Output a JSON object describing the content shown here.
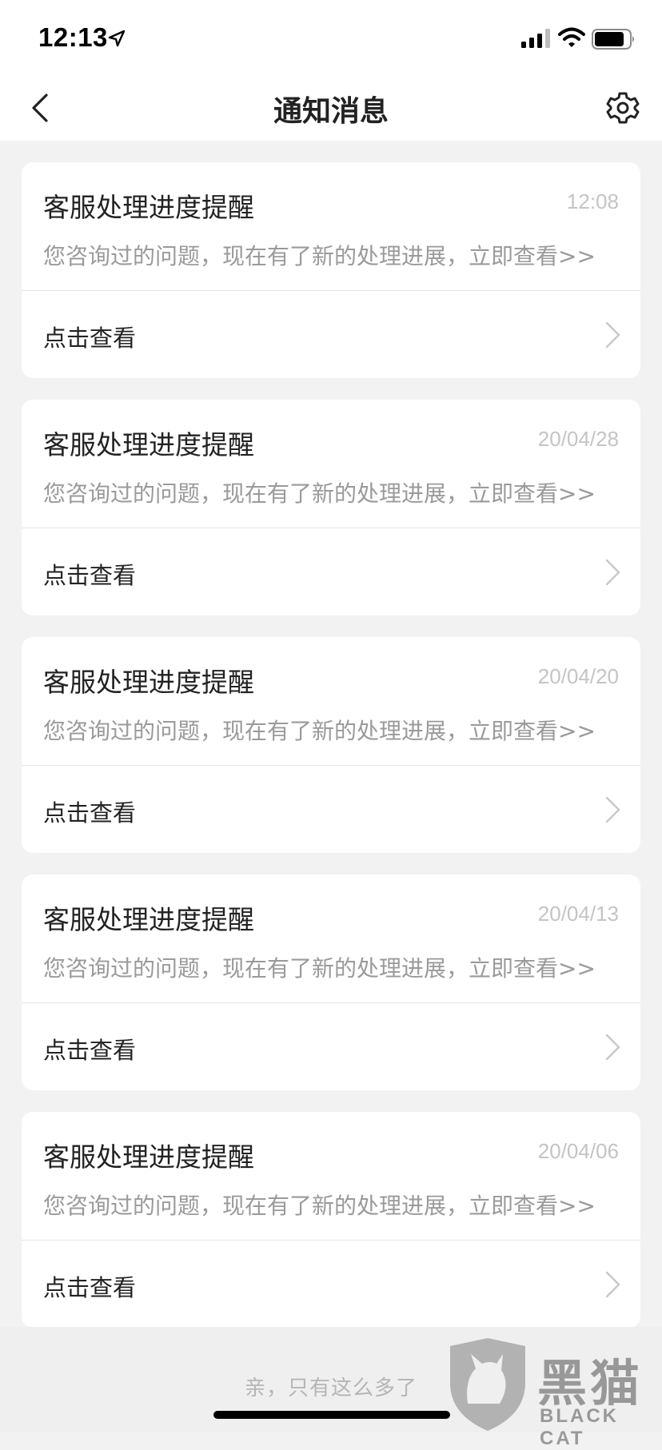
{
  "status_bar": {
    "time": "12:13"
  },
  "header": {
    "title": "通知消息"
  },
  "notifications": [
    {
      "title": "客服处理进度提醒",
      "time": "12:08",
      "desc": "您咨询过的问题，现在有了新的处理进展，立即查看>>",
      "action": "点击查看"
    },
    {
      "title": "客服处理进度提醒",
      "time": "20/04/28",
      "desc": "您咨询过的问题，现在有了新的处理进展，立即查看>>",
      "action": "点击查看"
    },
    {
      "title": "客服处理进度提醒",
      "time": "20/04/20",
      "desc": "您咨询过的问题，现在有了新的处理进展，立即查看>>",
      "action": "点击查看"
    },
    {
      "title": "客服处理进度提醒",
      "time": "20/04/13",
      "desc": "您咨询过的问题，现在有了新的处理进展，立即查看>>",
      "action": "点击查看"
    },
    {
      "title": "客服处理进度提醒",
      "time": "20/04/06",
      "desc": "您咨询过的问题，现在有了新的处理进展，立即查看>>",
      "action": "点击查看"
    }
  ],
  "footer": {
    "text": "亲，只有这么多了"
  },
  "watermark": {
    "label": "黑猫",
    "sub": "BLACK CAT"
  }
}
